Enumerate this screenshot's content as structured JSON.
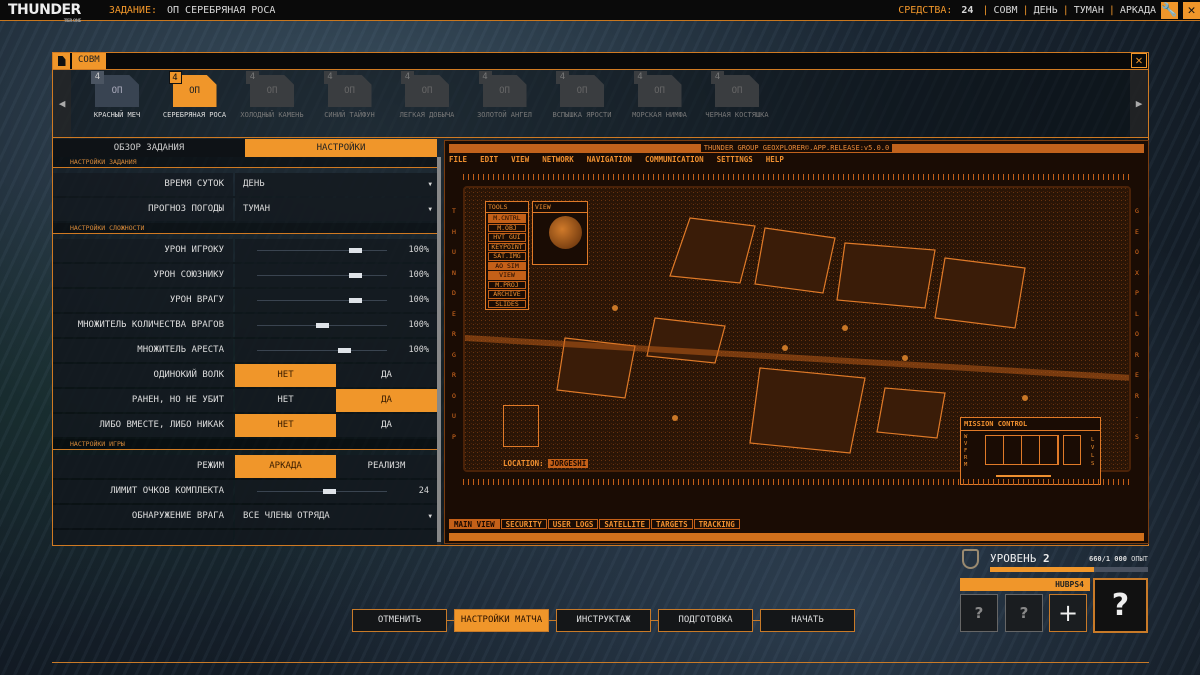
{
  "topbar": {
    "logo": "THUNDER",
    "logo_sub": "TIER ONE",
    "mission_label": "ЗАДАНИЕ:",
    "mission_value": "ОП СЕРЕБРЯНАЯ РОСА",
    "funds_label": "СРЕДСТВА:",
    "funds_value": "24",
    "status": [
      "СОВМ",
      "ДЕНЬ",
      "ТУМАН",
      "АРКАДА"
    ],
    "separator": "|",
    "icons": [
      "wrench-icon",
      "close-icon"
    ]
  },
  "window": {
    "tab": "СОВМ",
    "close": "✕"
  },
  "missions": [
    {
      "num": "4",
      "code": "ОП",
      "name": "КРАСНЫЙ МЕЧ",
      "state": "available"
    },
    {
      "num": "4",
      "code": "ОП",
      "name": "СЕРЕБРЯНАЯ РОСА",
      "state": "selected"
    },
    {
      "num": "4",
      "code": "ОП",
      "name": "ХОЛОДНЫЙ КАМЕНЬ",
      "state": "locked"
    },
    {
      "num": "4",
      "code": "ОП",
      "name": "СИНИЙ ТАЙФУН",
      "state": "locked"
    },
    {
      "num": "4",
      "code": "ОП",
      "name": "ЛЕГКАЯ ДОБЫЧА",
      "state": "locked"
    },
    {
      "num": "4",
      "code": "ОП",
      "name": "ЗОЛОТОЙ АНГЕЛ",
      "state": "locked"
    },
    {
      "num": "4",
      "code": "ОП",
      "name": "ВСПЫШКА ЯРОСТИ",
      "state": "locked"
    },
    {
      "num": "4",
      "code": "ОП",
      "name": "МОРСКАЯ НИМФА",
      "state": "locked"
    },
    {
      "num": "4",
      "code": "ОП",
      "name": "ЧЕРНАЯ КОСТЯШКА",
      "state": "locked"
    }
  ],
  "tabs": [
    "ОБЗОР ЗАДАНИЯ",
    "НАСТРОЙКИ"
  ],
  "settings": {
    "sec1": "НАСТРОЙКИ ЗАДАНИЯ",
    "time": {
      "label": "ВРЕМЯ СУТОК",
      "value": "ДЕНЬ"
    },
    "weather": {
      "label": "ПРОГНОЗ ПОГОДЫ",
      "value": "ТУМАН"
    },
    "sec2": "НАСТРОЙКИ СЛОЖНОСТИ",
    "sliders": [
      {
        "label": "УРОН ИГРОКУ",
        "value": "100%",
        "fraction": 0.75
      },
      {
        "label": "УРОН СОЮЗНИКУ",
        "value": "100%",
        "fraction": 0.75
      },
      {
        "label": "УРОН ВРАГУ",
        "value": "100%",
        "fraction": 0.75
      },
      {
        "label": "МНОЖИТЕЛЬ КОЛИЧЕСТВА ВРАГОВ",
        "value": "100%",
        "fraction": 0.5
      },
      {
        "label": "МНОЖИТЕЛЬ АРЕСТА",
        "value": "100%",
        "fraction": 0.67
      }
    ],
    "toggles": [
      {
        "label": "ОДИНОКИЙ ВОЛК",
        "no": "НЕТ",
        "yes": "ДА",
        "selected": "no"
      },
      {
        "label": "РАНЕН, НО НЕ УБИТ",
        "no": "НЕТ",
        "yes": "ДА",
        "selected": "yes"
      },
      {
        "label": "ЛИБО ВМЕСТЕ, ЛИБО НИКАК",
        "no": "НЕТ",
        "yes": "ДА",
        "selected": "no"
      }
    ],
    "sec3": "НАСТРОЙКИ ИГРЫ",
    "mode": {
      "label": "РЕЖИМ",
      "a": "АРКАДА",
      "b": "РЕАЛИЗМ",
      "selected": "a"
    },
    "kit": {
      "label": "ЛИМИТ ОЧКОВ КОМПЛЕКТА",
      "value": "24",
      "fraction": 0.55
    },
    "detect": {
      "label": "ОБНАРУЖЕНИЕ ВРАГА",
      "value": "ВСЕ ЧЛЕНЫ ОТРЯДА"
    }
  },
  "map": {
    "title": "THUNDER GROUP GEOXPLORER©.APP.RELEASE:v5.0.0",
    "menu": [
      "FILE",
      "EDIT",
      "VIEW",
      "NETWORK",
      "NAVIGATION",
      "COMMUNICATION",
      "SETTINGS",
      "HELP"
    ],
    "left_vertical": "THUNDERGROUP",
    "right_vertical": "GEOXPLORER.S",
    "tools_title": "TOOLS",
    "tools": [
      "M.CNTRL",
      "M.OBJ",
      "HVT GUI",
      "KEYPOINT",
      "SAT.IMG",
      "AO SIM",
      "VIEW",
      "M.PROJ",
      "ARCHIVE",
      "SLIDES"
    ],
    "view_title": "VIEW",
    "mission_control": "MISSION CONTROL",
    "waveform": "WVFRM",
    "levels": "LVLS",
    "location_label": "LOCATION:",
    "location_value": "JORGESHI",
    "bottom_tabs": [
      "MAIN VIEW",
      "SECURITY",
      "USER LOGS",
      "SATELLITE",
      "TARGETS",
      "TRACKING"
    ]
  },
  "player": {
    "level_label": "УРОВЕНЬ",
    "level": "2",
    "xp": "660/1 000",
    "xp_label": "ОПЫТ",
    "xp_fraction": 0.66,
    "name": "HUBPS4",
    "slots": [
      "?",
      "?",
      "+"
    ],
    "main_slot": "?"
  },
  "nav": [
    "ОТМЕНИТЬ",
    "НАСТРОЙКИ МАТЧА",
    "ИНСТРУКТАЖ",
    "ПОДГОТОВКА",
    "НАЧАТЬ"
  ],
  "colors": {
    "accent": "#f0962a",
    "map_bg": "#1a0c04"
  }
}
